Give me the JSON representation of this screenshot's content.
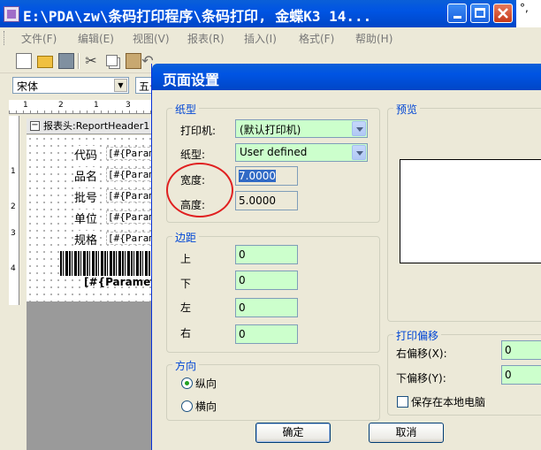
{
  "app": {
    "title": "E:\\PDA\\zw\\条码打印程序\\条码打印, 金蝶K3 14...",
    "right_strip_text": "°,"
  },
  "menu": [
    "文件(F)",
    "编辑(E)",
    "视图(V)",
    "报表(R)",
    "插入(I)",
    "格式(F)",
    "帮助(H)"
  ],
  "toolbar": {
    "icons": [
      "new-icon",
      "open-icon",
      "save-icon",
      "cut-icon",
      "copy-icon",
      "paste-icon",
      "undo-icon",
      "redo-icon"
    ],
    "undo_glyph": "↶",
    "redo_glyph": "↷",
    "cut_glyph": "✂"
  },
  "format": {
    "font": "宋体",
    "size": "五号"
  },
  "ruler": {
    "h_numbers": [
      "1",
      "2",
      "1",
      "3"
    ],
    "v_numbers": [
      "1",
      "2",
      "3",
      "4"
    ]
  },
  "report": {
    "band_toggle": "−",
    "band_title": "报表头:ReportHeader1",
    "fields": [
      {
        "label": "代码",
        "param": "[#{Param"
      },
      {
        "label": "品名",
        "param": "[#{Param"
      },
      {
        "label": "批号",
        "param": "[#{Param"
      },
      {
        "label": "单位",
        "param": "[#{Param"
      },
      {
        "label": "规格",
        "param": "[#{Param"
      }
    ],
    "barcode_text": "[#{Paramete"
  },
  "dialog": {
    "title": "页面设置",
    "paper_group": "纸型",
    "printer_label": "打印机:",
    "printer_value": "(默认打印机)",
    "paper_label": "纸型:",
    "paper_value": "User defined",
    "width_label": "宽度:",
    "width_value": "7.0000",
    "height_label": "高度:",
    "height_value": "5.0000",
    "margin_group": "边距",
    "margins": [
      {
        "label": "上",
        "value": "0"
      },
      {
        "label": "下",
        "value": "0"
      },
      {
        "label": "左",
        "value": "0"
      },
      {
        "label": "右",
        "value": "0"
      }
    ],
    "orientation_group": "方向",
    "portrait": "纵向",
    "landscape": "横向",
    "orientation_selected": "纵向",
    "preview_group": "预览",
    "offset_group": "打印偏移",
    "right_offset_label": "右偏移(X):",
    "right_offset_value": "0",
    "bottom_offset_label": "下偏移(Y):",
    "bottom_offset_value": "0",
    "save_local_label": "保存在本地电脑",
    "save_local_checked": false,
    "ok_label": "确定",
    "cancel_label": "取消"
  },
  "colors": {
    "title_blue": "#0054e3",
    "input_green": "#ccffcc",
    "group_label_blue": "#0046d5",
    "annotation_red": "#e02020",
    "selection_blue": "#316ac5"
  }
}
